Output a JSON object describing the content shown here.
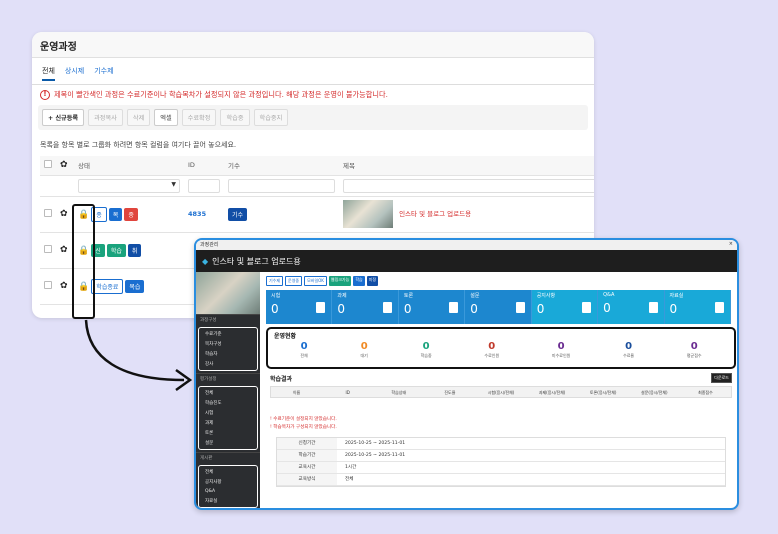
{
  "bg": {
    "title": "운영과정",
    "tabs": [
      "전체",
      "상시제",
      "기수제"
    ],
    "warning": "제목이 빨간색인 과정은 수료기준이나 학습목차가 설정되지 않은 과정입니다. 해당 과정은 운영이 불가능합니다.",
    "toolbar": [
      "+ 신규등록",
      "과정복사",
      "삭제",
      "엑셀",
      "수료확정",
      "학습중",
      "학습중지"
    ],
    "group_hint": "목록을 항목 별로 그룹화 하려면 항목 컬럼을 여기다 끌어 놓으세요.",
    "columns": {
      "status": "상태",
      "id": "ID",
      "gisu": "기수",
      "title": "제목"
    },
    "rows": [
      {
        "tags": [
          "종",
          "복",
          "중"
        ],
        "id": "4835",
        "gisu": "기수",
        "title": "인스타 및 블로그 업로드용"
      },
      {
        "tags": [
          "신",
          "학습",
          "취"
        ]
      },
      {
        "tags": [
          "학습종료",
          "복습"
        ]
      }
    ]
  },
  "popup": {
    "header": "과정관리",
    "close": "×",
    "title": "인스타 및 블로그 업로드용",
    "chips": [
      "기수제",
      "운영중",
      "모바일OK",
      "웹링크가능",
      "학습",
      "미정"
    ],
    "cards": [
      {
        "label": "시험",
        "value": "0"
      },
      {
        "label": "과제",
        "value": "0"
      },
      {
        "label": "토론",
        "value": "0"
      },
      {
        "label": "설문",
        "value": "0"
      },
      {
        "label": "공지사항",
        "value": "0"
      },
      {
        "label": "Q&A",
        "value": "0"
      },
      {
        "label": "자료실",
        "value": "0"
      }
    ],
    "status_title": "운영현황",
    "status": [
      {
        "value": "0",
        "label": "전체",
        "color": "#1a6ed0"
      },
      {
        "value": "0",
        "label": "대기",
        "color": "#f08a24"
      },
      {
        "value": "0",
        "label": "학습중",
        "color": "#1aa37d"
      },
      {
        "value": "0",
        "label": "수료인원",
        "color": "#c0392b"
      },
      {
        "value": "0",
        "label": "미수료인원",
        "color": "#6a2c91"
      },
      {
        "value": "0",
        "label": "수료율",
        "color": "#1a4e9c"
      },
      {
        "value": "0",
        "label": "평균점수",
        "color": "#6a2c91"
      }
    ],
    "result_title": "학습결과",
    "download": "다운로드",
    "result_cols": [
      "이름",
      "ID",
      "학습상태",
      "진도율",
      "시험(응시/전체)",
      "과제(응시/전체)",
      "토론(응시/전체)",
      "설문(응시/전체)",
      "최종점수"
    ],
    "notes": [
      "! 수료기준이 설정되지 않았습니다.",
      "! 학습목차가 구성되지 않았습니다."
    ],
    "info": [
      {
        "k": "신청기간",
        "v": "2025-10-25 ~ 2025-11-01"
      },
      {
        "k": "학습기간",
        "v": "2025-10-25 ~ 2025-11-01"
      },
      {
        "k": "교육시간",
        "v": "1시간"
      },
      {
        "k": "교육방식",
        "v": "전체"
      }
    ],
    "side": {
      "sec1": "과정구성",
      "g1": [
        "수료기준",
        "목차구성",
        "학습자",
        "강사"
      ],
      "sec2": "평가설정",
      "g2": [
        "전체",
        "학습진도",
        "시험",
        "과제",
        "토론",
        "설문"
      ],
      "sec3": "게시판",
      "g3": [
        "전체",
        "공지사항",
        "Q&A",
        "자료실"
      ]
    }
  }
}
